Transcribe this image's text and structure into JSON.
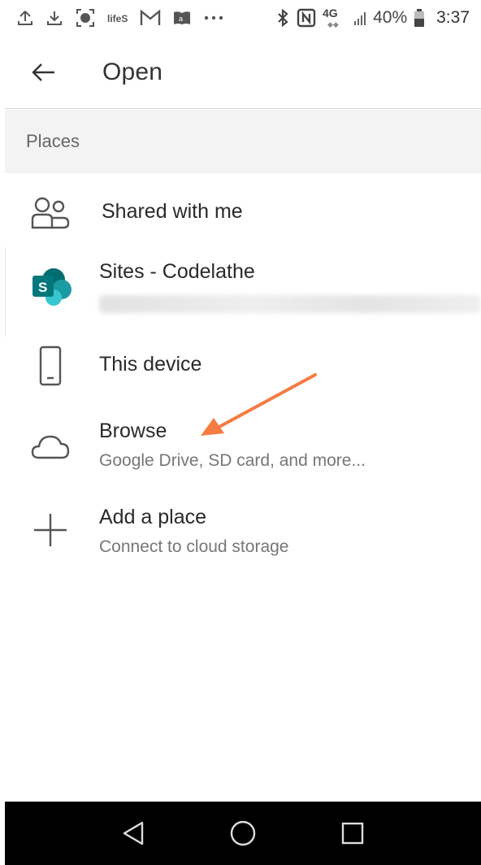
{
  "status_bar": {
    "battery_percent": "40%",
    "time": "3:37",
    "network": "4G",
    "icons": [
      "upload-icon",
      "download-icon",
      "screen-record-icon",
      "carrier-icon",
      "gmail-icon",
      "amazon-icon",
      "more-dots-icon",
      "bluetooth-icon",
      "nfc-icon",
      "signal-icon",
      "battery-icon"
    ]
  },
  "app_bar": {
    "back_icon": "back-arrow-icon",
    "title": "Open"
  },
  "places_header": "Places",
  "places": [
    {
      "title": "Shared with me",
      "icon": "people-icon"
    },
    {
      "title": "Sites - Codelathe",
      "icon": "sharepoint-icon",
      "sharepoint_letter": "S",
      "brand_color": "#038387"
    },
    {
      "title": "This device",
      "icon": "phone-icon"
    },
    {
      "title": "Browse",
      "subtitle": "Google Drive, SD card, and more...",
      "icon": "cloud-icon"
    },
    {
      "title": "Add a place",
      "subtitle": "Connect to cloud storage",
      "icon": "plus-icon"
    }
  ],
  "annotation": {
    "color": "#f47b42",
    "icon": "annotation-arrow-icon"
  },
  "nav_bar": {
    "icons": [
      "nav-back-icon",
      "nav-home-icon",
      "nav-recents-icon"
    ]
  }
}
